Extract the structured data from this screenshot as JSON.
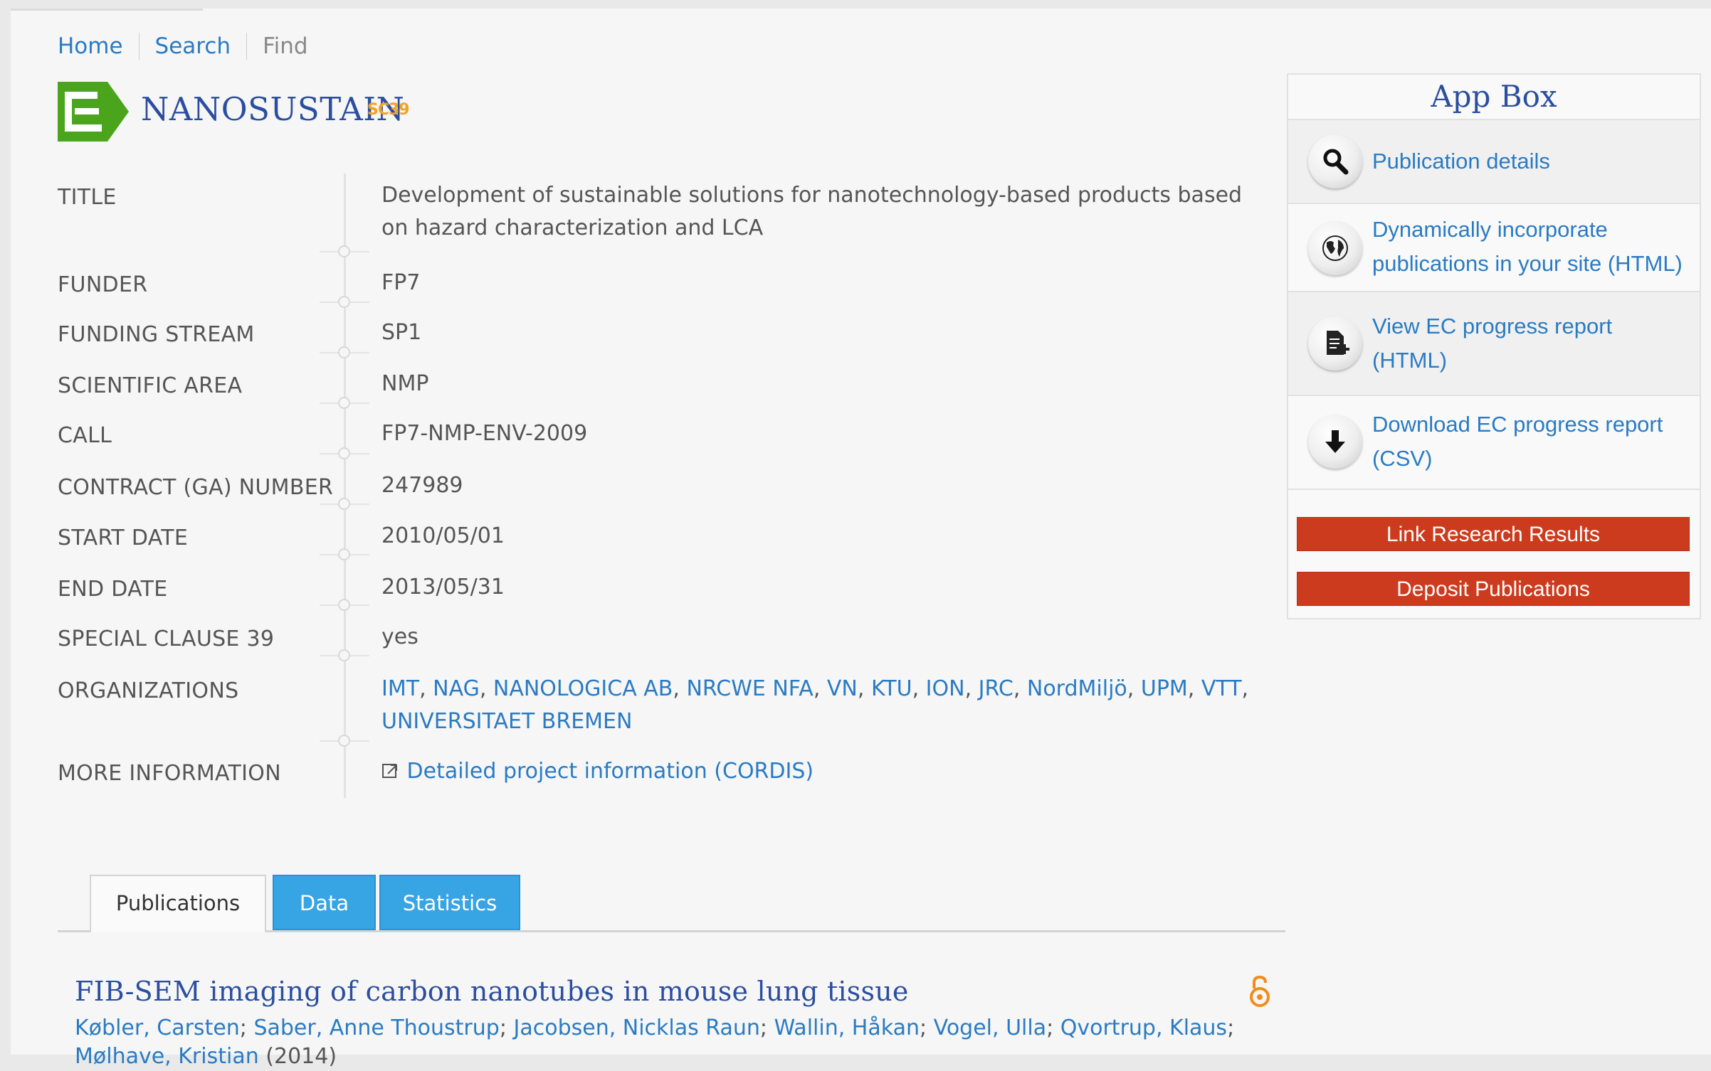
{
  "breadcrumb": {
    "items": [
      {
        "label": "Home"
      },
      {
        "label": "Search"
      },
      {
        "label": "Find"
      }
    ]
  },
  "project": {
    "acronym": "NANOSUSTAIN",
    "badge": "SC39"
  },
  "details": [
    {
      "label": "TITLE",
      "value": "Development of sustainable solutions for nanotechnology-based products based on hazard characterization and LCA"
    },
    {
      "label": "FUNDER",
      "value": "FP7"
    },
    {
      "label": "FUNDING STREAM",
      "value": "SP1"
    },
    {
      "label": "SCIENTIFIC AREA",
      "value": "NMP"
    },
    {
      "label": "CALL",
      "value": "FP7-NMP-ENV-2009"
    },
    {
      "label": "CONTRACT (GA) NUMBER",
      "value": "247989"
    },
    {
      "label": "START DATE",
      "value": "2010/05/01"
    },
    {
      "label": "END DATE",
      "value": "2013/05/31"
    },
    {
      "label": "SPECIAL CLAUSE 39",
      "value": "yes"
    },
    {
      "label": "ORGANIZATIONS",
      "value": ""
    },
    {
      "label": "MORE INFORMATION",
      "value": "Detailed project information (CORDIS)"
    }
  ],
  "organizations": [
    "IMT",
    "NAG",
    "NANOLOGICA AB",
    "NRCWE NFA",
    "VN",
    "KTU",
    "ION",
    "JRC",
    "NordMiljö",
    "UPM",
    "VTT",
    "UNIVERSITAET BREMEN"
  ],
  "appbox": {
    "title": "App Box",
    "items": [
      {
        "label": "Publication details",
        "icon": "search-icon"
      },
      {
        "label": "Dynamically incorporate publications in your site (HTML)",
        "icon": "globe-icon"
      },
      {
        "label": "View EC progress report (HTML)",
        "icon": "document-add-icon"
      },
      {
        "label": "Download EC progress report (CSV)",
        "icon": "download-arrow-icon"
      }
    ],
    "buttons": [
      "Link Research Results",
      "Deposit Publications"
    ]
  },
  "tabs": [
    {
      "label": "Publications",
      "active": true
    },
    {
      "label": "Data",
      "active": false
    },
    {
      "label": "Statistics",
      "active": false
    }
  ],
  "publication": {
    "title": "FIB-SEM imaging of carbon nanotubes in mouse lung tissue",
    "authors": [
      "Købler, Carsten",
      "Saber, Anne Thoustrup",
      "Jacobsen, Nicklas Raun",
      "Wallin, Håkan",
      "Vogel, Ulla",
      "Qvortrup, Klaus",
      "Mølhave, Kristian"
    ],
    "year": "(2014)",
    "access_icon": "open-access-icon"
  },
  "colors": {
    "link": "#2a7bc4",
    "heading": "#2b4ea0",
    "tab_blue": "#37a4e4",
    "button_red": "#cd3b1e",
    "logo_green": "#4aa51c",
    "badge_orange": "#f1a321"
  }
}
